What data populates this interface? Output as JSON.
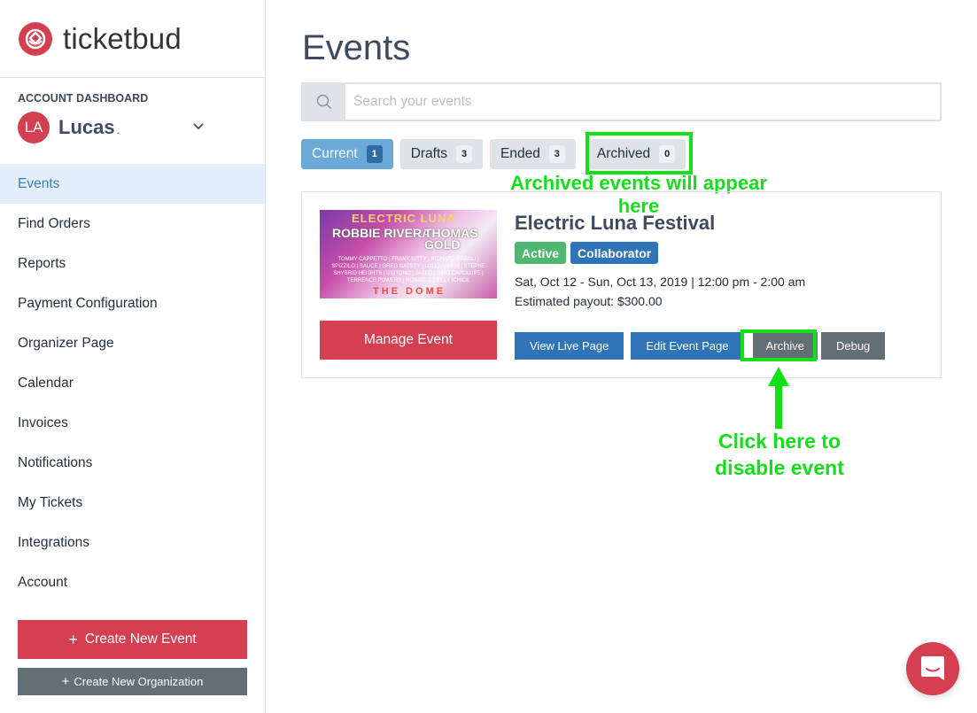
{
  "brand": {
    "name": "ticketbud",
    "color": "#d43f51"
  },
  "sidebar": {
    "section_label": "ACCOUNT DASHBOARD",
    "user": {
      "initials": "LA",
      "name": "Lucas",
      "suffix": "."
    },
    "items": [
      {
        "label": "Events",
        "active": true
      },
      {
        "label": "Find Orders"
      },
      {
        "label": "Reports"
      },
      {
        "label": "Payment Configuration"
      },
      {
        "label": "Organizer Page"
      },
      {
        "label": "Calendar"
      },
      {
        "label": "Invoices"
      },
      {
        "label": "Notifications"
      },
      {
        "label": "My Tickets"
      },
      {
        "label": "Integrations"
      },
      {
        "label": "Account"
      }
    ],
    "create_event_label": "Create New Event",
    "create_org_label": "Create New Organization"
  },
  "main": {
    "title": "Events",
    "search": {
      "placeholder": "Search your events",
      "value": ""
    },
    "tabs": [
      {
        "label": "Current",
        "count": "1",
        "active": true
      },
      {
        "label": "Drafts",
        "count": "3"
      },
      {
        "label": "Ended",
        "count": "3"
      },
      {
        "label": "Archived",
        "count": "0"
      }
    ],
    "event": {
      "title": "Electric Luna Festival",
      "badges": [
        "Active",
        "Collaborator"
      ],
      "date": "Sat, Oct 12 - Sun, Oct 13, 2019 | 12:00 pm - 2:00 am",
      "payout": "Estimated payout: $300.00",
      "image": {
        "title": "ELECTRIC LUNA",
        "headliner1": "ROBBIE RIVERA",
        "headliner2": "THOMAS GOLD",
        "lineup": "TOMMY CAPPETTO | FRANK NITTY | RICHARD PRAGLI | SPIZZILO | SAUCE | GREG GATSBY | LOLLIVIAHEM | STEPHE SHYBRID HEIGHTS | UNITONO | JASKO | DINO CAPOLUPE | TERRENCE POWERS | RONNIE D | SILLY ICHICK",
        "venue": "THE DOME"
      },
      "manage_label": "Manage Event",
      "actions": [
        "View Live Page",
        "Edit Event Page",
        "Archive",
        "Debug"
      ]
    }
  },
  "annotations": {
    "archived_note": "Archived events will appear here",
    "archive_note_line1": "Click here to",
    "archive_note_line2": "disable event",
    "highlight_color": "#14e01a"
  }
}
